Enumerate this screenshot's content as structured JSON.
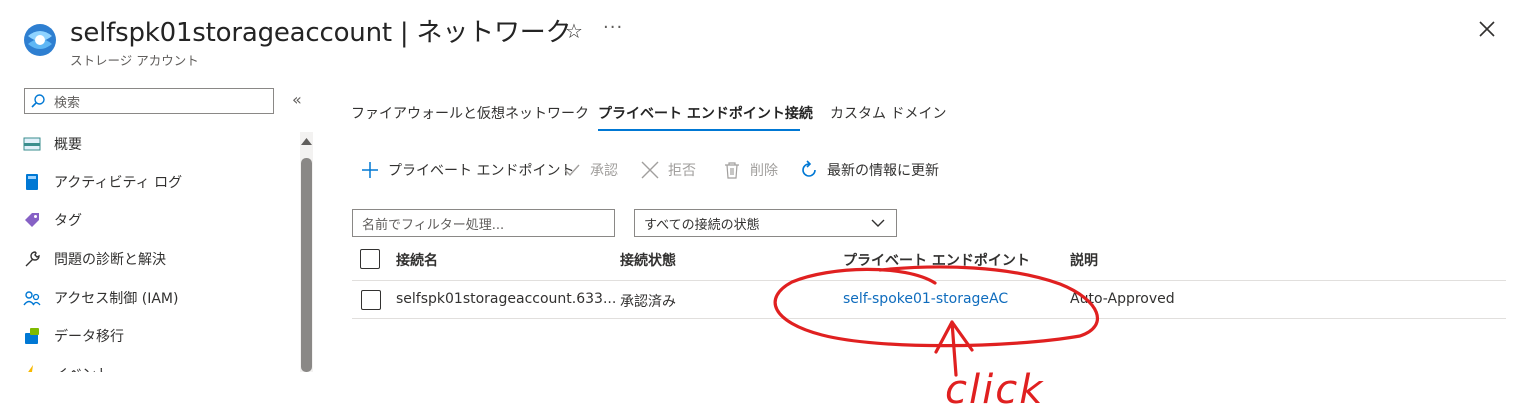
{
  "header": {
    "title": "selfspk01storageaccount | ネットワーク",
    "subtitle": "ストレージ アカウント",
    "more": "···"
  },
  "sidebar": {
    "search_placeholder": "検索",
    "collapse": "«",
    "items": [
      {
        "label": "概要",
        "icon": "overview-icon"
      },
      {
        "label": "アクティビティ ログ",
        "icon": "activity-log-icon"
      },
      {
        "label": "タグ",
        "icon": "tag-icon"
      },
      {
        "label": "問題の診断と解決",
        "icon": "wrench-icon"
      },
      {
        "label": "アクセス制御 (IAM)",
        "icon": "people-icon"
      },
      {
        "label": "データ移行",
        "icon": "data-migration-icon"
      },
      {
        "label": "イベント",
        "icon": "events-icon"
      }
    ]
  },
  "tabs": [
    {
      "label": "ファイアウォールと仮想ネットワーク",
      "active": false
    },
    {
      "label": "プライベート エンドポイント接続",
      "active": true
    },
    {
      "label": "カスタム ドメイン",
      "active": false
    }
  ],
  "toolbar": {
    "add_private_endpoint": "プライベート エンドポイント",
    "approve": "承認",
    "reject": "拒否",
    "delete": "削除",
    "refresh": "最新の情報に更新"
  },
  "filters": {
    "name_placeholder": "名前でフィルター処理...",
    "status_selected": "すべての接続の状態"
  },
  "table": {
    "columns": [
      "接続名",
      "接続状態",
      "プライベート エンドポイント",
      "説明"
    ],
    "rows": [
      {
        "connection_name": "selfspk01storageaccount.633...",
        "status": "承認済み",
        "private_endpoint": "self-spoke01-storageAC",
        "description": "Auto-Approved"
      }
    ]
  },
  "annotation": {
    "text": "click",
    "color": "#e02020"
  },
  "colors": {
    "accent": "#0078d4",
    "link": "#0f6cbd"
  }
}
